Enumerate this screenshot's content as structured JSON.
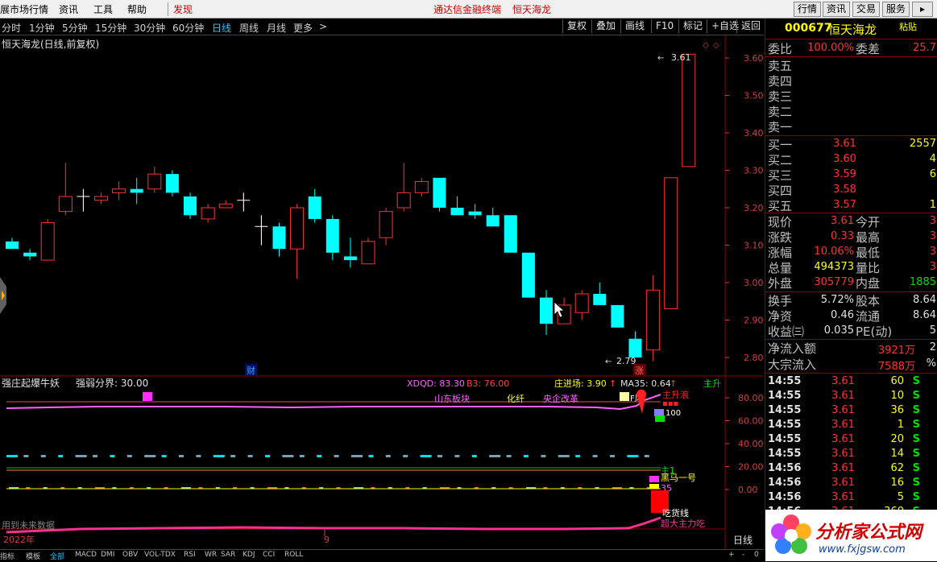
{
  "menu": {
    "items": [
      "展市场行情",
      "资讯",
      "工具",
      "帮助"
    ],
    "discover": "发现",
    "center_title": "通达信金融终端",
    "center_stock": "恒天海龙",
    "right_buttons": [
      "行情",
      "资讯",
      "交易",
      "服务"
    ]
  },
  "periods": {
    "items": [
      "分时",
      "1分钟",
      "5分钟",
      "15分钟",
      "30分钟",
      "60分钟",
      "日线",
      "周线",
      "月线",
      "更多"
    ],
    "active": "日线",
    "more_arrow": ">",
    "toolbar": [
      "复权",
      "叠加",
      "画线",
      "F10",
      "标记",
      "+自选",
      "返回"
    ]
  },
  "chart_title": "恒天海龙(日线,前复权)",
  "main_chart": {
    "price_ticks": [
      "3.60",
      "3.50",
      "3.40",
      "3.30",
      "3.20",
      "3.10",
      "3.00",
      "2.90",
      "2.80"
    ],
    "high_label": "3.61",
    "low_label": "2.79",
    "cai_marker": "财",
    "zhang_marker": "涨"
  },
  "indicator": {
    "name": "强庄起爆牛妖",
    "threshold_label": "强弱分界: 30.00",
    "xdqd": "XDQD: 83.30",
    "b3": "B3: 76.00",
    "zhuang": "庄进场: 3.90",
    "ma35": "MA35: 0.64",
    "zhusheng": "主升",
    "ticks": [
      "80.00",
      "60.00",
      "40.00",
      "20.00",
      "0.00"
    ],
    "concepts": [
      "山东板块",
      "化纤",
      "央企改革"
    ],
    "labels": {
      "feng": "F风",
      "zhushengbo": "主升浪",
      "v100": "100",
      "zhu1": "主1",
      "heima": "黑马一号",
      "v35": "35",
      "chihuo": "吃货线",
      "chaoda": "超大主力吃"
    },
    "future_note": "用到未来数据"
  },
  "xaxis": {
    "year": "2022年",
    "month": "9"
  },
  "bottom_tabs": [
    "指标",
    "模板",
    "全部",
    "MACD",
    "DMI",
    "OBV",
    "VOL-TDX",
    "RSI",
    "WR",
    "SAR",
    "KDJ",
    "CCI",
    "ROLL"
  ],
  "bottom_right": {
    "period": "日线",
    "controls": [
      "+",
      "-",
      "0"
    ]
  },
  "quote": {
    "code": "000677",
    "name": "恒天海龙",
    "paste": "粘贴",
    "weibi_label": "委比",
    "weibi_value": "100.00%",
    "weicha_label": "委差",
    "weicha_value": "25.7",
    "sells": [
      "卖五",
      "卖四",
      "卖三",
      "卖二",
      "卖一"
    ],
    "buys": [
      {
        "label": "买一",
        "price": "3.61",
        "vol": "2557"
      },
      {
        "label": "买二",
        "price": "3.60",
        "vol": "4"
      },
      {
        "label": "买三",
        "price": "3.59",
        "vol": "6"
      },
      {
        "label": "买四",
        "price": "3.58",
        "vol": ""
      },
      {
        "label": "买五",
        "price": "3.57",
        "vol": "1"
      }
    ],
    "stats": [
      {
        "l1": "现价",
        "v1": "3.61",
        "c1": "red",
        "l2": "今开",
        "v2": "3"
      },
      {
        "l1": "涨跌",
        "v1": "0.33",
        "c1": "red",
        "l2": "最高",
        "v2": "3"
      },
      {
        "l1": "涨幅",
        "v1": "10.06%",
        "c1": "red",
        "l2": "最低",
        "v2": "3"
      },
      {
        "l1": "总量",
        "v1": "494373",
        "c1": "yel",
        "l2": "量比",
        "v2": "3"
      },
      {
        "l1": "外盘",
        "v1": "305779",
        "c1": "red",
        "l2": "内盘",
        "v2": "1885"
      }
    ],
    "stats2": [
      {
        "l1": "换手",
        "v1": "5.72%",
        "l2": "股本",
        "v2": "8.64"
      },
      {
        "l1": "净资",
        "v1": "0.46",
        "l2": "流通",
        "v2": "8.64"
      },
      {
        "l1": "收益㈢",
        "v1": "0.035",
        "l2": "PE(动)",
        "v2": "5"
      }
    ],
    "flows": [
      {
        "label": "净流入额",
        "value": "3921万",
        "tail": "2"
      },
      {
        "label": "大宗流入",
        "value": "7588万",
        "tail": "%"
      }
    ],
    "ticks": [
      {
        "time": "14:55",
        "price": "3.61",
        "vol": "60",
        "side": "S"
      },
      {
        "time": "14:55",
        "price": "3.61",
        "vol": "10",
        "side": "S"
      },
      {
        "time": "14:55",
        "price": "3.61",
        "vol": "36",
        "side": "S"
      },
      {
        "time": "14:55",
        "price": "3.61",
        "vol": "1",
        "side": "S"
      },
      {
        "time": "14:55",
        "price": "3.61",
        "vol": "20",
        "side": "S"
      },
      {
        "time": "14:55",
        "price": "3.61",
        "vol": "14",
        "side": "S"
      },
      {
        "time": "14:56",
        "price": "3.61",
        "vol": "62",
        "side": "S"
      },
      {
        "time": "14:56",
        "price": "3.61",
        "vol": "16",
        "side": "S"
      },
      {
        "time": "14:56",
        "price": "3.61",
        "vol": "5",
        "side": "S"
      },
      {
        "time": "14:56",
        "price": "3.61",
        "vol": "360",
        "side": "S"
      }
    ]
  },
  "watermark": {
    "cn": "分析家公式网",
    "url": "www.fxjgsw.com"
  },
  "colors": {
    "up": "#ff3232",
    "down": "#00ffff",
    "accent": "#30c0ff"
  },
  "candles": [
    {
      "o": 3.11,
      "h": 3.12,
      "l": 3.09,
      "c": 3.09
    },
    {
      "o": 3.08,
      "h": 3.09,
      "l": 3.06,
      "c": 3.07
    },
    {
      "o": 3.06,
      "h": 3.17,
      "l": 3.06,
      "c": 3.16
    },
    {
      "o": 3.19,
      "h": 3.32,
      "l": 3.18,
      "c": 3.23
    },
    {
      "o": 3.23,
      "h": 3.25,
      "l": 3.19,
      "c": 3.23
    },
    {
      "o": 3.22,
      "h": 3.24,
      "l": 3.21,
      "c": 3.23
    },
    {
      "o": 3.24,
      "h": 3.27,
      "l": 3.22,
      "c": 3.25
    },
    {
      "o": 3.25,
      "h": 3.28,
      "l": 3.21,
      "c": 3.24
    },
    {
      "o": 3.25,
      "h": 3.31,
      "l": 3.24,
      "c": 3.29
    },
    {
      "o": 3.29,
      "h": 3.3,
      "l": 3.23,
      "c": 3.24
    },
    {
      "o": 3.23,
      "h": 3.24,
      "l": 3.17,
      "c": 3.18
    },
    {
      "o": 3.17,
      "h": 3.21,
      "l": 3.16,
      "c": 3.2
    },
    {
      "o": 3.2,
      "h": 3.22,
      "l": 3.2,
      "c": 3.21
    },
    {
      "o": 3.22,
      "h": 3.24,
      "l": 3.19,
      "c": 3.22
    },
    {
      "o": 3.15,
      "h": 3.18,
      "l": 3.1,
      "c": 3.15
    },
    {
      "o": 3.15,
      "h": 3.16,
      "l": 3.07,
      "c": 3.09
    },
    {
      "o": 3.09,
      "h": 3.21,
      "l": 3.01,
      "c": 3.2
    },
    {
      "o": 3.23,
      "h": 3.25,
      "l": 3.16,
      "c": 3.17
    },
    {
      "o": 3.17,
      "h": 3.18,
      "l": 3.06,
      "c": 3.08
    },
    {
      "o": 3.07,
      "h": 3.12,
      "l": 3.04,
      "c": 3.06
    },
    {
      "o": 3.05,
      "h": 3.12,
      "l": 3.05,
      "c": 3.11
    },
    {
      "o": 3.12,
      "h": 3.2,
      "l": 3.1,
      "c": 3.19
    },
    {
      "o": 3.2,
      "h": 3.32,
      "l": 3.19,
      "c": 3.24
    },
    {
      "o": 3.24,
      "h": 3.28,
      "l": 3.23,
      "c": 3.27
    },
    {
      "o": 3.28,
      "h": 3.28,
      "l": 3.19,
      "c": 3.2
    },
    {
      "o": 3.2,
      "h": 3.23,
      "l": 3.18,
      "c": 3.18
    },
    {
      "o": 3.19,
      "h": 3.21,
      "l": 3.17,
      "c": 3.18
    },
    {
      "o": 3.18,
      "h": 3.2,
      "l": 3.15,
      "c": 3.15
    },
    {
      "o": 3.18,
      "h": 3.18,
      "l": 3.08,
      "c": 3.08
    },
    {
      "o": 3.08,
      "h": 3.08,
      "l": 2.96,
      "c": 2.96
    },
    {
      "o": 2.96,
      "h": 2.98,
      "l": 2.86,
      "c": 2.89
    },
    {
      "o": 2.89,
      "h": 2.96,
      "l": 2.89,
      "c": 2.94
    },
    {
      "o": 2.92,
      "h": 2.98,
      "l": 2.9,
      "c": 2.97
    },
    {
      "o": 2.97,
      "h": 3.0,
      "l": 2.94,
      "c": 2.94
    },
    {
      "o": 2.94,
      "h": 2.94,
      "l": 2.88,
      "c": 2.88
    },
    {
      "o": 2.85,
      "h": 2.87,
      "l": 2.8,
      "c": 2.8
    },
    {
      "o": 2.82,
      "h": 3.02,
      "l": 2.79,
      "c": 2.98
    },
    {
      "o": 2.93,
      "h": 3.28,
      "l": 2.93,
      "c": 3.28
    },
    {
      "o": 3.31,
      "h": 3.61,
      "l": 3.31,
      "c": 3.61
    }
  ]
}
